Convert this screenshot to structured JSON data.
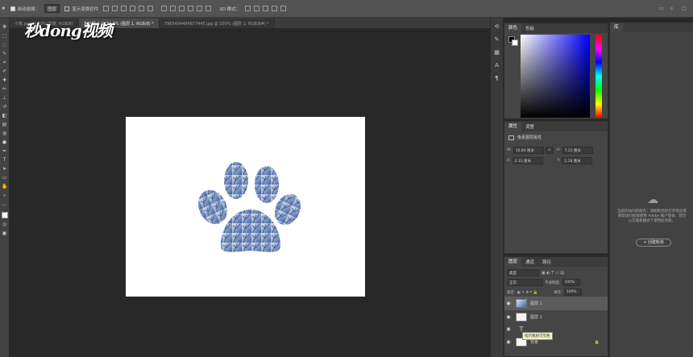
{
  "options_bar": {
    "auto_select_label": "自动选择：",
    "auto_select_value": "图层",
    "show_transform_label": "显示变换控件",
    "mode_3d_label": "3D 模式："
  },
  "tabs": [
    {
      "label": "小熊.psd @ 50%(背景, RGB/8)",
      "active": false
    },
    {
      "label": "未标题-1 @ 34.5% (图层 1, RGB/8) *",
      "active": true
    },
    {
      "label": "7965494484877445.jpg @ 100% (图层 1, RGB/8#) *",
      "active": false
    }
  ],
  "watermark": "秒dong视频",
  "color_panel": {
    "tabs": [
      "颜色",
      "色板"
    ]
  },
  "properties_panel": {
    "tabs": [
      "属性",
      "调整"
    ],
    "title": "像素图层属性",
    "w_label": "W:",
    "w_value": "16.84 厘米",
    "h_label": "H:",
    "h_value": "7.22 厘米",
    "x_label": "X:",
    "x_value": "2.31 厘米",
    "y_label": "Y:",
    "y_value": "2.18 厘米",
    "link_icon": "link-icon"
  },
  "layers_panel": {
    "tabs": [
      "图层",
      "通道",
      "路径"
    ],
    "filter_label": "类型",
    "blend_mode": "正常",
    "opacity_label": "不透明度:",
    "opacity_value": "100%",
    "lock_label": "锁定:",
    "fill_label": "填充:",
    "fill_value": "100%",
    "layers": [
      {
        "name": "图层 1",
        "selected": true
      },
      {
        "name": "图层 2",
        "selected": false
      },
      {
        "name": "T",
        "selected": false
      },
      {
        "name": "背景",
        "selected": false
      }
    ],
    "tooltip": "指示图层可见性"
  },
  "learn_panel": {
    "tab": "库",
    "message": "当前的访问的服务：请刷新后的打开预览或获取访问权限使用 Adobe 账户登录，您可以在联机模式下使用此功能。",
    "create_button": "+ 创建新库"
  },
  "colors": {
    "ui_dark": "#282828",
    "panel": "#454545",
    "accent": "#3d6bb3"
  }
}
